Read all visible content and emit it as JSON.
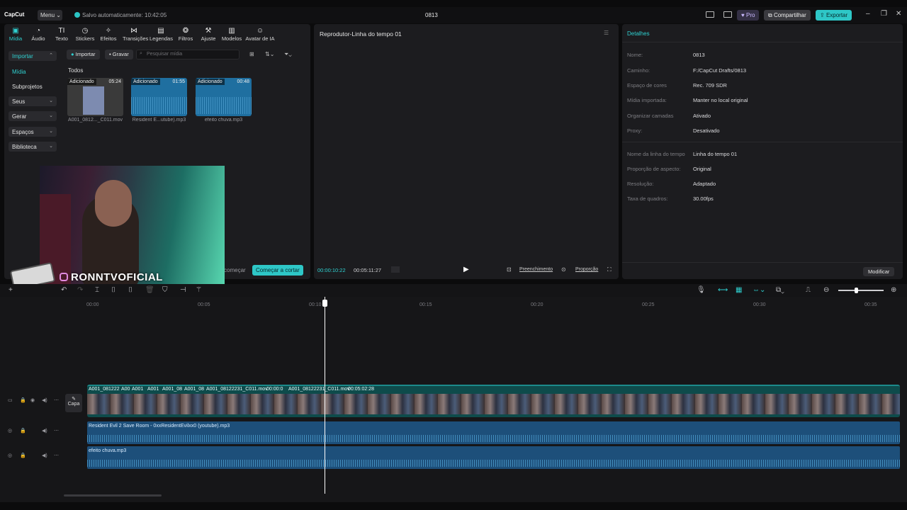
{
  "titlebar": {
    "app_name": "CapCut",
    "menu_label": "Menu",
    "saved_status": "Salvo automaticamente: 10:42:05",
    "project_title": "0813",
    "pro_label": "Pro",
    "share_label": "Compartilhar",
    "export_label": "Exportar"
  },
  "toolbar": {
    "tools": [
      {
        "label": "Mídia",
        "icon": "media-icon",
        "active": true
      },
      {
        "label": "Áudio",
        "icon": "audio-icon"
      },
      {
        "label": "Texto",
        "icon": "text-icon"
      },
      {
        "label": "Stickers",
        "icon": "sticker-icon"
      },
      {
        "label": "Efeitos",
        "icon": "effects-icon"
      },
      {
        "label": "Transições",
        "icon": "transitions-icon"
      },
      {
        "label": "Legendas",
        "icon": "captions-icon"
      },
      {
        "label": "Filtros",
        "icon": "filters-icon"
      },
      {
        "label": "Ajuste",
        "icon": "adjust-icon"
      },
      {
        "label": "Modelos",
        "icon": "templates-icon"
      },
      {
        "label": "Avatar de IA",
        "icon": "ai-avatar-icon"
      }
    ]
  },
  "sidebar": {
    "import": "Importar",
    "media": "Mídia",
    "subprojects": "Subprojetos",
    "yours": "Seus",
    "generate": "Gerar",
    "spaces": "Espaços",
    "library": "Biblioteca"
  },
  "media": {
    "import_btn": "Importar",
    "record_btn": "Gravar",
    "search_placeholder": "Pesquisar mídia",
    "section_all": "Todos",
    "items": [
      {
        "tag": "Adicionado",
        "duration": "05:24",
        "name": "A001_0812..._C011.mov",
        "kind": "video"
      },
      {
        "tag": "Adicionado",
        "duration": "01:55",
        "name": "Resident E...utube).mp3",
        "kind": "audio"
      },
      {
        "tag": "Adicionado",
        "duration": "00:48",
        "name": "efeito chuva.mp3",
        "kind": "audio"
      }
    ],
    "start_hint": "começar",
    "cut_btn": "Começar a cortar",
    "watermark": "RONNTVOFICIAL"
  },
  "player": {
    "title": "Reprodutor-Linha do tempo 01",
    "current_time": "00:00:10:22",
    "total_time": "00:05:11:27",
    "fill_label": "Preenchimento",
    "ratio_label": "Proporção"
  },
  "details": {
    "title": "Detalhes",
    "rows": [
      {
        "k": "Nome:",
        "v": "0813"
      },
      {
        "k": "Caminho:",
        "v": "F:/CapCut Drafts/0813"
      },
      {
        "k": "Espaço de cores",
        "v": "Rec. 709 SDR"
      },
      {
        "k": "Mídia importada:",
        "v": "Manter no local original"
      },
      {
        "k": "Organizar camadas",
        "v": "Ativado"
      },
      {
        "k": "Proxy:",
        "v": "Desativado"
      },
      {
        "k": "Nome da linha do tempo",
        "v": "Linha do tempo 01"
      },
      {
        "k": "Proporção de aspecto:",
        "v": "Original"
      },
      {
        "k": "Resolução:",
        "v": "Adaptado"
      },
      {
        "k": "Taxa de quadros:",
        "v": "30.00fps"
      }
    ],
    "modify_btn": "Modificar"
  },
  "timeline": {
    "ruler": [
      "00:00",
      "00:05",
      "00:10",
      "00:15",
      "00:20",
      "00:25",
      "00:30",
      "00:35"
    ],
    "cover_label": "Capa",
    "video_labels": [
      "A001_081222",
      "A00",
      "A001",
      "A001",
      "A001_08",
      "A001_08",
      "A001_08122231_C011.mov",
      "00:00:0",
      "A001_08122231_C011.mov",
      "00:05:02:28"
    ],
    "audio1_label": "Resident Evil 2 Save Room - 0xxResidentEvilxx0 (youtube).mp3",
    "audio2_label": "efeito chuva.mp3"
  }
}
